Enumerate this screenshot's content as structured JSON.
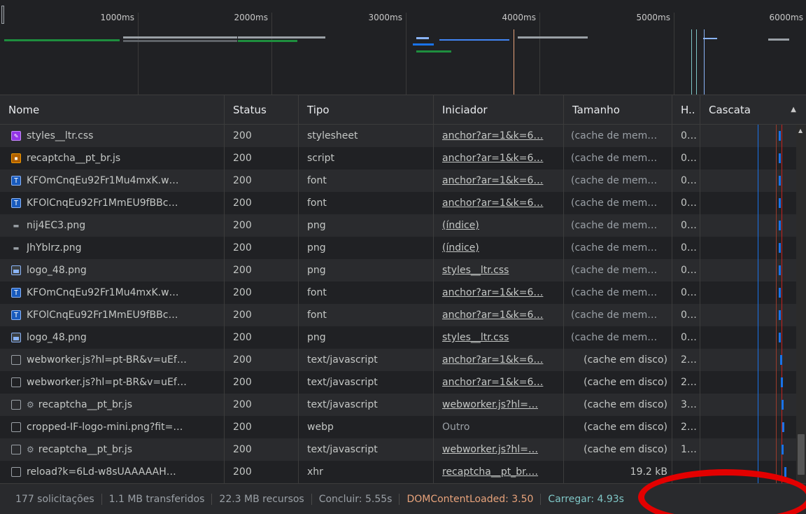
{
  "overview": {
    "ticks": [
      "1000ms",
      "2000ms",
      "3000ms",
      "4000ms",
      "5000ms",
      "6000ms"
    ]
  },
  "columns": {
    "name": "Nome",
    "status": "Status",
    "type": "Tipo",
    "initiator": "Iniciador",
    "size": "Tamanho",
    "time": "H..",
    "waterfall": "Cascata"
  },
  "rows": [
    {
      "icon": "css-file-icon",
      "gear": false,
      "name": "styles__ltr.css",
      "status": "200",
      "type": "stylesheet",
      "initiator": "anchor?ar=1&k=6…",
      "initiator_link": true,
      "size": "(cache de mem…",
      "time": "0…"
    },
    {
      "icon": "script-file-icon",
      "gear": false,
      "name": "recaptcha__pt_br.js",
      "status": "200",
      "type": "script",
      "initiator": "anchor?ar=1&k=6…",
      "initiator_link": true,
      "size": "(cache de mem…",
      "time": "0…"
    },
    {
      "icon": "font-file-icon",
      "gear": false,
      "name": "KFOmCnqEu92Fr1Mu4mxK.w…",
      "status": "200",
      "type": "font",
      "initiator": "anchor?ar=1&k=6…",
      "initiator_link": true,
      "size": "(cache de mem…",
      "time": "0…"
    },
    {
      "icon": "font-file-icon",
      "gear": false,
      "name": "KFOlCnqEu92Fr1MmEU9fBBc…",
      "status": "200",
      "type": "font",
      "initiator": "anchor?ar=1&k=6…",
      "initiator_link": true,
      "size": "(cache de mem…",
      "time": "0…"
    },
    {
      "icon": "image-file-icon",
      "gear": false,
      "name": "nij4EC3.png",
      "status": "200",
      "type": "png",
      "initiator": "(índice)",
      "initiator_link": true,
      "size": "(cache de mem…",
      "time": "0…"
    },
    {
      "icon": "image-file-icon",
      "gear": false,
      "name": "JhYblrz.png",
      "status": "200",
      "type": "png",
      "initiator": "(índice)",
      "initiator_link": true,
      "size": "(cache de mem…",
      "time": "0…"
    },
    {
      "icon": "image-preview-icon",
      "gear": false,
      "name": "logo_48.png",
      "status": "200",
      "type": "png",
      "initiator": "styles__ltr.css",
      "initiator_link": true,
      "size": "(cache de mem…",
      "time": "0…"
    },
    {
      "icon": "font-file-icon",
      "gear": false,
      "name": "KFOmCnqEu92Fr1Mu4mxK.w…",
      "status": "200",
      "type": "font",
      "initiator": "anchor?ar=1&k=6…",
      "initiator_link": true,
      "size": "(cache de mem…",
      "time": "0…"
    },
    {
      "icon": "font-file-icon",
      "gear": false,
      "name": "KFOlCnqEu92Fr1MmEU9fBBc…",
      "status": "200",
      "type": "font",
      "initiator": "anchor?ar=1&k=6…",
      "initiator_link": true,
      "size": "(cache de mem…",
      "time": "0…"
    },
    {
      "icon": "image-preview-icon",
      "gear": false,
      "name": "logo_48.png",
      "status": "200",
      "type": "png",
      "initiator": "styles__ltr.css",
      "initiator_link": true,
      "size": "(cache de mem…",
      "time": "0…"
    },
    {
      "icon": "document-file-icon",
      "gear": false,
      "name": "webworker.js?hl=pt-BR&v=uEf…",
      "status": "200",
      "type": "text/javascript",
      "initiator": "anchor?ar=1&k=6…",
      "initiator_link": true,
      "size": "(cache em disco)",
      "time": "2…"
    },
    {
      "icon": "document-file-icon",
      "gear": false,
      "name": "webworker.js?hl=pt-BR&v=uEf…",
      "status": "200",
      "type": "text/javascript",
      "initiator": "anchor?ar=1&k=6…",
      "initiator_link": true,
      "size": "(cache em disco)",
      "time": "2…"
    },
    {
      "icon": "document-file-icon",
      "gear": true,
      "name": "recaptcha__pt_br.js",
      "status": "200",
      "type": "text/javascript",
      "initiator": "webworker.js?hl=…",
      "initiator_link": true,
      "size": "(cache em disco)",
      "time": "3…"
    },
    {
      "icon": "document-file-icon",
      "gear": false,
      "name": "cropped-IF-logo-mini.png?fit=…",
      "status": "200",
      "type": "webp",
      "initiator": "Outro",
      "initiator_link": false,
      "size": "(cache em disco)",
      "time": "2…"
    },
    {
      "icon": "document-file-icon",
      "gear": true,
      "name": "recaptcha__pt_br.js",
      "status": "200",
      "type": "text/javascript",
      "initiator": "webworker.js?hl=…",
      "initiator_link": true,
      "size": "(cache em disco)",
      "time": "1…"
    },
    {
      "icon": "document-file-icon",
      "gear": false,
      "name": "reload?k=6Ld-w8sUAAAAAH…",
      "status": "200",
      "type": "xhr",
      "initiator": "recaptcha__pt_br.…",
      "initiator_link": true,
      "size": "19.2 kB",
      "time": ""
    }
  ],
  "statusbar": {
    "requests": "177 solicitações",
    "transferred": "1.1 MB transferidos",
    "resources": "22.3 MB recursos",
    "finish": "Concluir: 5.55s",
    "dom_content_loaded": "DOMContentLoaded: 3.50",
    "load": "Carregar: 4.93s"
  },
  "colors": {
    "dom_content_loaded": "#e8a37b",
    "load": "#7fc6c6",
    "annotation_circle": "#e30000"
  }
}
